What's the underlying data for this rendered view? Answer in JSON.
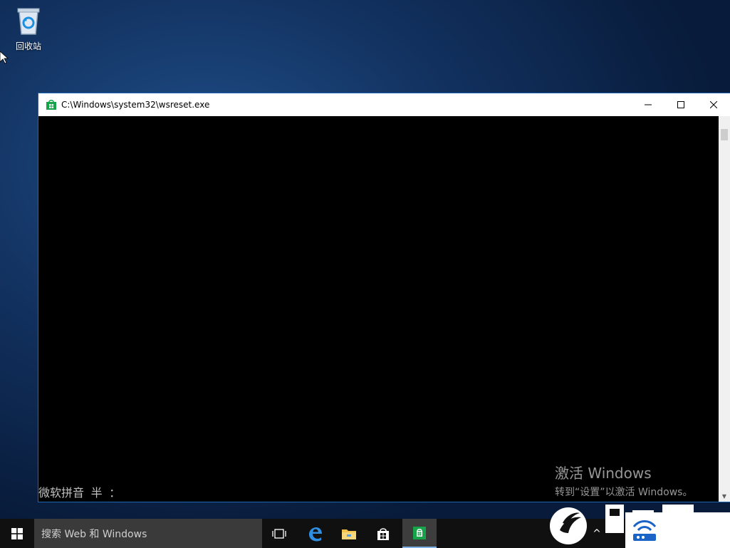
{
  "desktop": {
    "recycle_bin_label": "回收站"
  },
  "window": {
    "title": "C:\\Windows\\system32\\wsreset.exe",
    "ime_status": "微软拼音 半 ："
  },
  "activation": {
    "title": "激活 Windows",
    "subtitle": "转到“设置”以激活 Windows。"
  },
  "taskbar": {
    "search_placeholder": "搜索 Web 和 Windows",
    "items": [
      {
        "name": "task-view",
        "icon": "task-view-icon"
      },
      {
        "name": "edge",
        "icon": "edge-icon"
      },
      {
        "name": "file-explorer",
        "icon": "folder-icon"
      },
      {
        "name": "store",
        "icon": "store-icon"
      },
      {
        "name": "wsreset",
        "icon": "store-green-icon"
      }
    ]
  },
  "colors": {
    "accent": "#1e66b2",
    "store_green": "#16a34a"
  }
}
